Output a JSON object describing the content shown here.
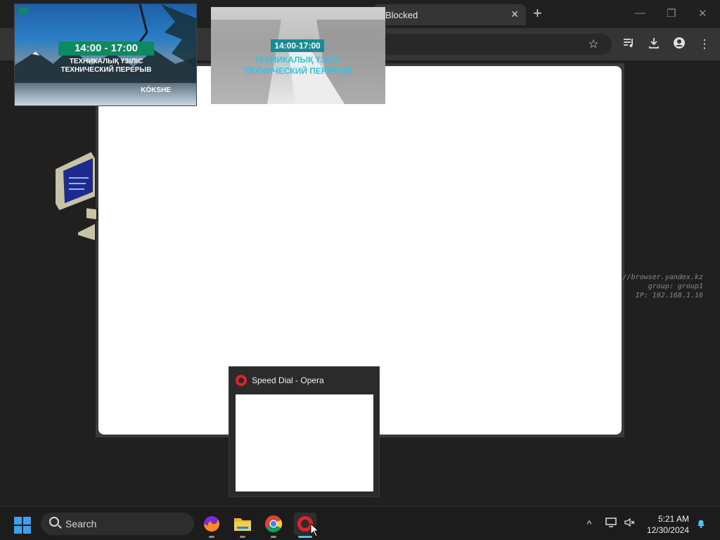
{
  "browser": {
    "active_tab_title": "Blocked",
    "tab_close_glyph": "✕",
    "new_tab_glyph": "+",
    "window_controls": {
      "minimize": "—",
      "restore": "❐",
      "close": "✕"
    },
    "toolbar_icons": [
      "star-icon",
      "media-playlist-icon",
      "download-icon",
      "profile-icon",
      "kebab-menu-icon"
    ]
  },
  "side_info": {
    "line1": "//browser.yandex.kz",
    "line2": "group: group1",
    "line3": "IP: 192.168.1.16"
  },
  "thumbnails": {
    "first": {
      "time": "14:00 - 17:00",
      "line1": "ТЕХНИКАЛЫҚ ҮЗІЛІС",
      "line2": "ТЕХНИЧЕСКИЙ ПЕРЕРЫВ",
      "channel": "KÓKSHE"
    },
    "second": {
      "time": "14:00-17:00",
      "line1": "ТЕХНИКАЛЫҚ ҮЗІЛІС",
      "line2": "ТЕХНИЧЕСКИЙ ПЕРЕРЫВ"
    }
  },
  "taskbar_preview": {
    "title": "Speed Dial - Opera"
  },
  "taskbar": {
    "search_label": "Search",
    "apps": [
      "firefox-icon",
      "file-explorer-icon",
      "chrome-icon",
      "opera-icon"
    ],
    "time": "5:21 AM",
    "date": "12/30/2024",
    "tray": [
      "chevron-up-icon",
      "network-icon",
      "volume-muted-icon",
      "notification-bell-icon"
    ]
  },
  "colors": {
    "accent": "#4cc2ff",
    "opera_red": "#e1222a",
    "tk_badge_green": "#0d8a62",
    "tk_badge_teal": "#188a93"
  }
}
